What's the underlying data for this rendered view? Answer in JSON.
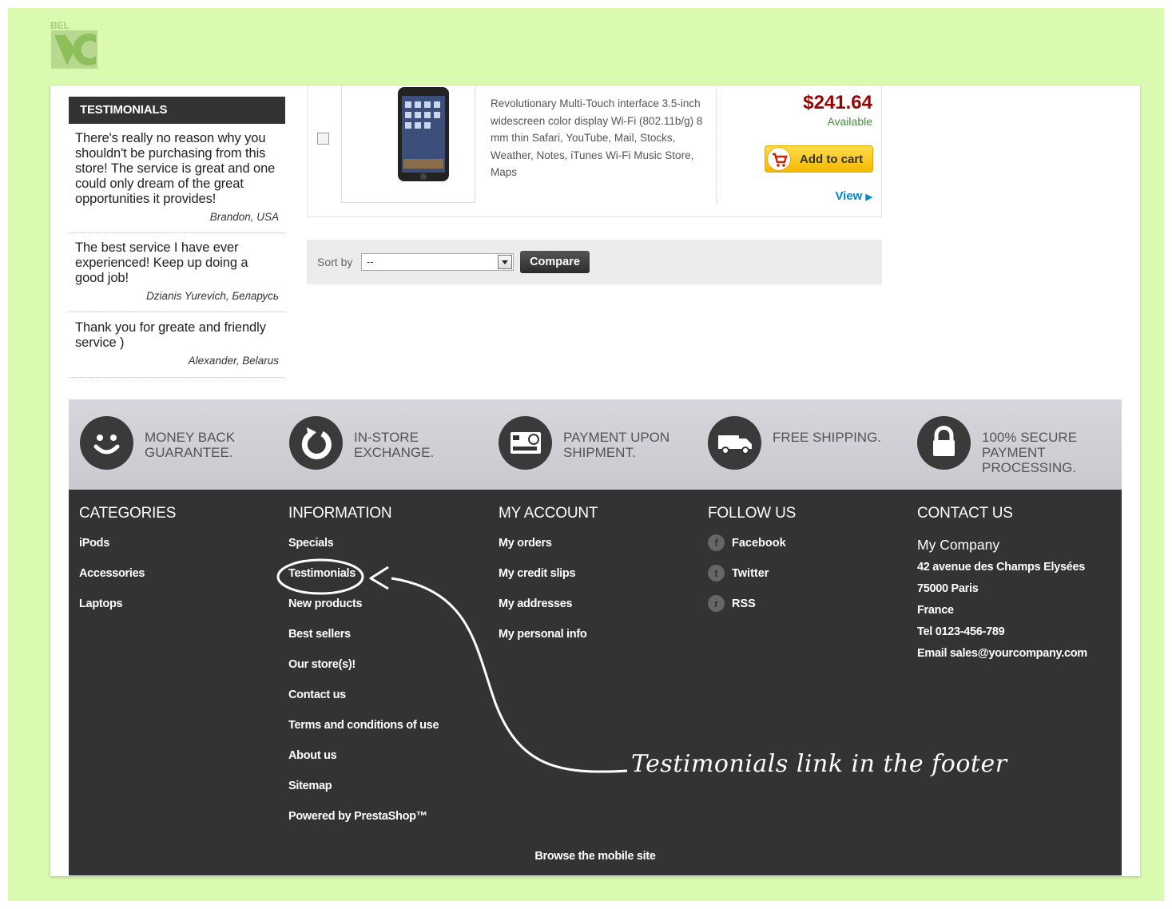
{
  "testimonials": {
    "title": "TESTIMONIALS",
    "items": [
      {
        "text": "There's really no reason why you shouldn't be purchasing from this store! The service is great and one could only dream of the great opportunities it provides!",
        "author": "Brandon, USA"
      },
      {
        "text": "The best service I have ever experienced! Keep up doing a good job!",
        "author": "Dzianis Yurevich, Беларусь"
      },
      {
        "text": "Thank you for greate and friendly service )",
        "author": "Alexander, Belarus"
      }
    ]
  },
  "product": {
    "description": "Revolutionary Multi-Touch interface 3.5-inch widescreen color display Wi-Fi (802.11b/g) 8 mm thin Safari, YouTube, Mail, Stocks, Weather, Notes, iTunes Wi-Fi Music Store, Maps",
    "price": "$241.64",
    "availability": "Available",
    "add_to_cart": "Add to cart",
    "view": "View"
  },
  "sort": {
    "label": "Sort by",
    "selected": "--",
    "compare": "Compare"
  },
  "reassurance": [
    {
      "icon": "smiley-icon",
      "text": "MONEY BACK GUARANTEE."
    },
    {
      "icon": "refresh-icon",
      "text": "IN-STORE EXCHANGE."
    },
    {
      "icon": "credit-card-icon",
      "text": "PAYMENT UPON SHIPMENT."
    },
    {
      "icon": "truck-icon",
      "text": "FREE SHIPPING."
    },
    {
      "icon": "lock-icon",
      "text": "100% SECURE PAYMENT PROCESSING."
    }
  ],
  "footer": {
    "categories": {
      "title": "CATEGORIES",
      "links": [
        "iPods",
        "Accessories",
        "Laptops"
      ]
    },
    "information": {
      "title": "INFORMATION",
      "links": [
        "Specials",
        "Testimonials",
        "New products",
        "Best sellers",
        "Our store(s)!",
        "Contact us",
        "Terms and conditions of use",
        "About us",
        "Sitemap",
        "Powered by PrestaShop™"
      ]
    },
    "account": {
      "title": "MY ACCOUNT",
      "links": [
        "My orders",
        "My credit slips",
        "My addresses",
        "My personal info"
      ]
    },
    "follow": {
      "title": "FOLLOW US",
      "links": [
        {
          "icon": "facebook-icon",
          "glyph": "f",
          "label": "Facebook"
        },
        {
          "icon": "twitter-icon",
          "glyph": "t",
          "label": "Twitter"
        },
        {
          "icon": "rss-icon",
          "glyph": "r",
          "label": "RSS"
        }
      ]
    },
    "contact": {
      "title": "CONTACT US",
      "company": "My Company",
      "lines": [
        "42 avenue des Champs Elysées",
        "75000 Paris",
        "France",
        "Tel 0123-456-789",
        "Email sales@yourcompany.com"
      ]
    },
    "mobile": "Browse the mobile site"
  },
  "annotation": "Testimonials link in the footer",
  "colors": {
    "background": "#dafab0",
    "footer": "#333333",
    "price": "#990000",
    "accent": "#0088cc"
  }
}
